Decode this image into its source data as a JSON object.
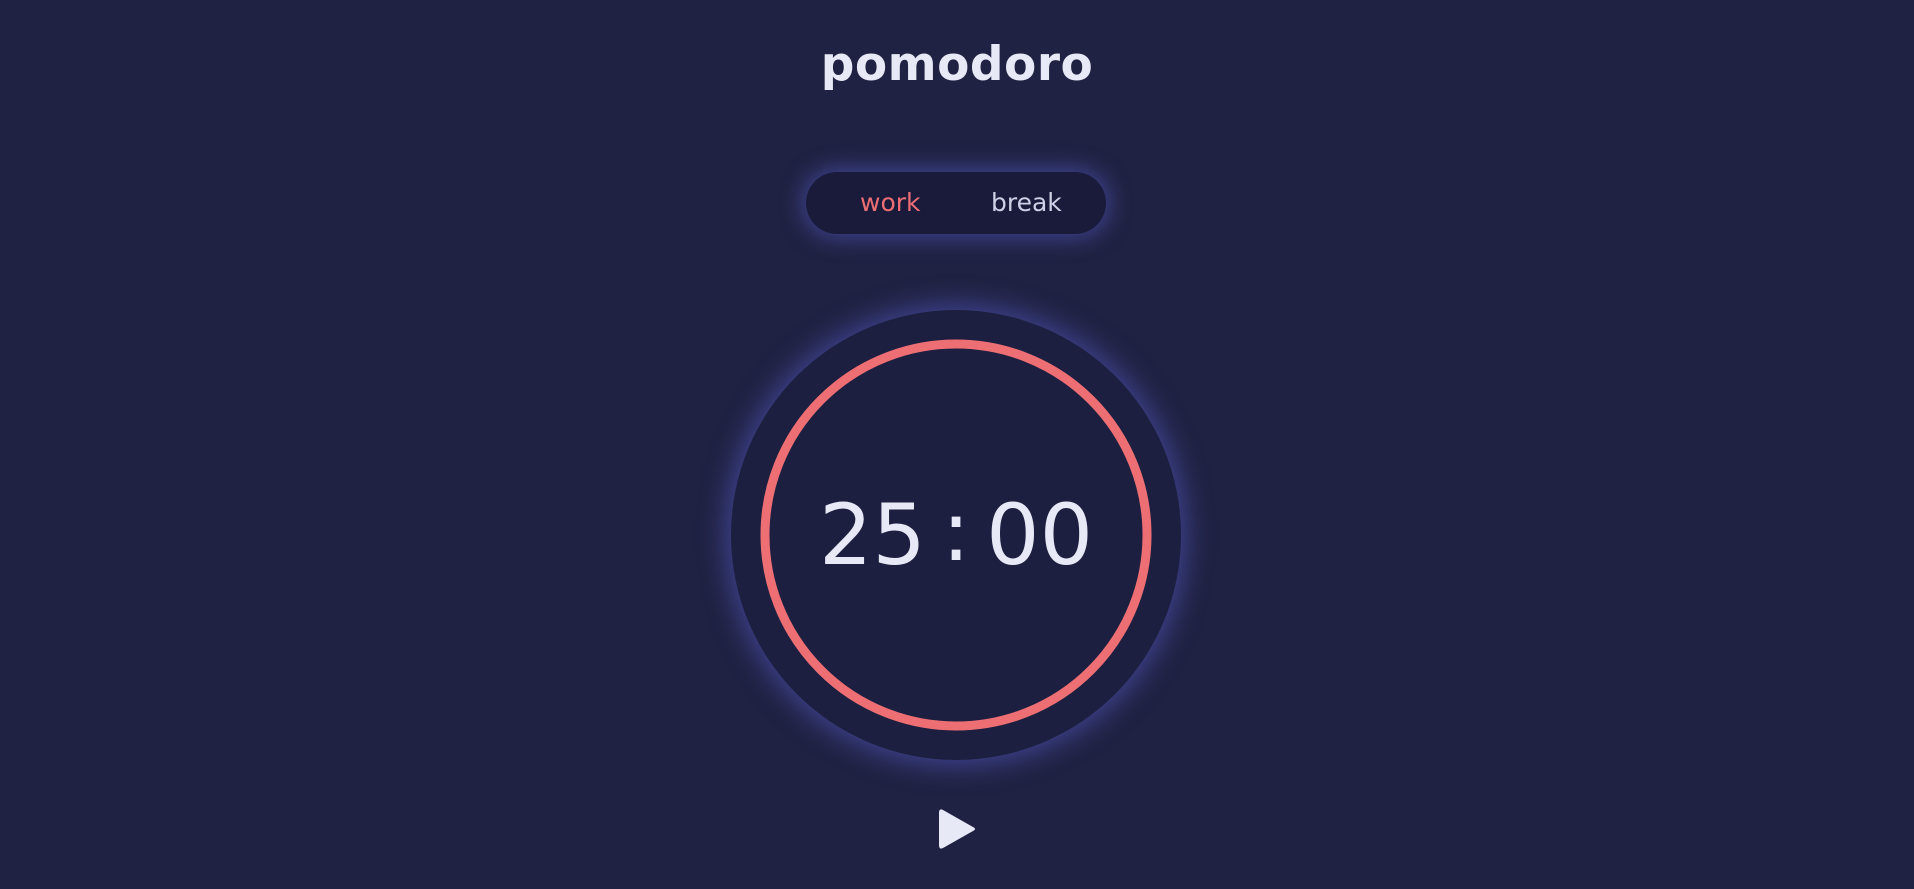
{
  "app": {
    "title": "pomodoro"
  },
  "modes": [
    {
      "label": "work",
      "active": true
    },
    {
      "label": "break",
      "active": false
    }
  ],
  "timer": {
    "minutes": "25",
    "separator": ":",
    "seconds": "00",
    "progress": 1.0
  },
  "controls": {
    "play_icon": "play-icon"
  },
  "colors": {
    "background": "#202243",
    "accent": "#ed6e73",
    "text": "#e8e9f6",
    "glow": "#585cc8"
  }
}
